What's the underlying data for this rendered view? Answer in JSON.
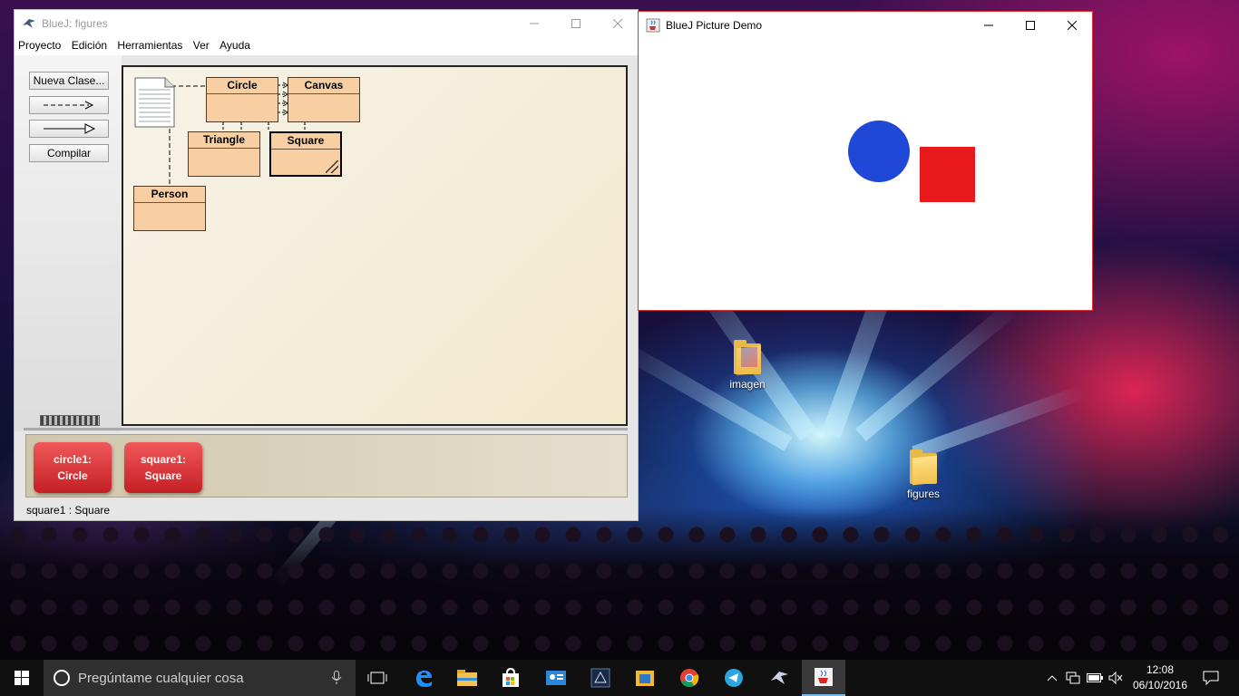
{
  "desktop": {
    "icons": [
      {
        "label": "imagen"
      },
      {
        "label": "figures"
      }
    ]
  },
  "bluej": {
    "title": "BlueJ:  figures",
    "menu": [
      "Proyecto",
      "Edición",
      "Herramientas",
      "Ver",
      "Ayuda"
    ],
    "tools": {
      "new_class": "Nueva Clase...",
      "dependency_arrow": "- - ->",
      "inheritance_arrow": "—▷",
      "compile": "Compilar"
    },
    "classes": [
      "Circle",
      "Canvas",
      "Triangle",
      "Square",
      "Person"
    ],
    "objects": [
      {
        "line1": "circle1:",
        "line2": "Circle"
      },
      {
        "line1": "square1:",
        "line2": "Square"
      }
    ],
    "status": "square1 : Square"
  },
  "demo": {
    "title": "BlueJ Picture Demo",
    "circle_color": "#1f48d6",
    "square_color": "#e8191a"
  },
  "taskbar": {
    "search_placeholder": "Pregúntame cualquier cosa",
    "time": "12:08",
    "date": "06/10/2016",
    "apps": [
      "task-view",
      "edge",
      "file-explorer",
      "store",
      "contacts",
      "unity",
      "folder",
      "chrome",
      "telegram",
      "bluej",
      "java"
    ]
  }
}
